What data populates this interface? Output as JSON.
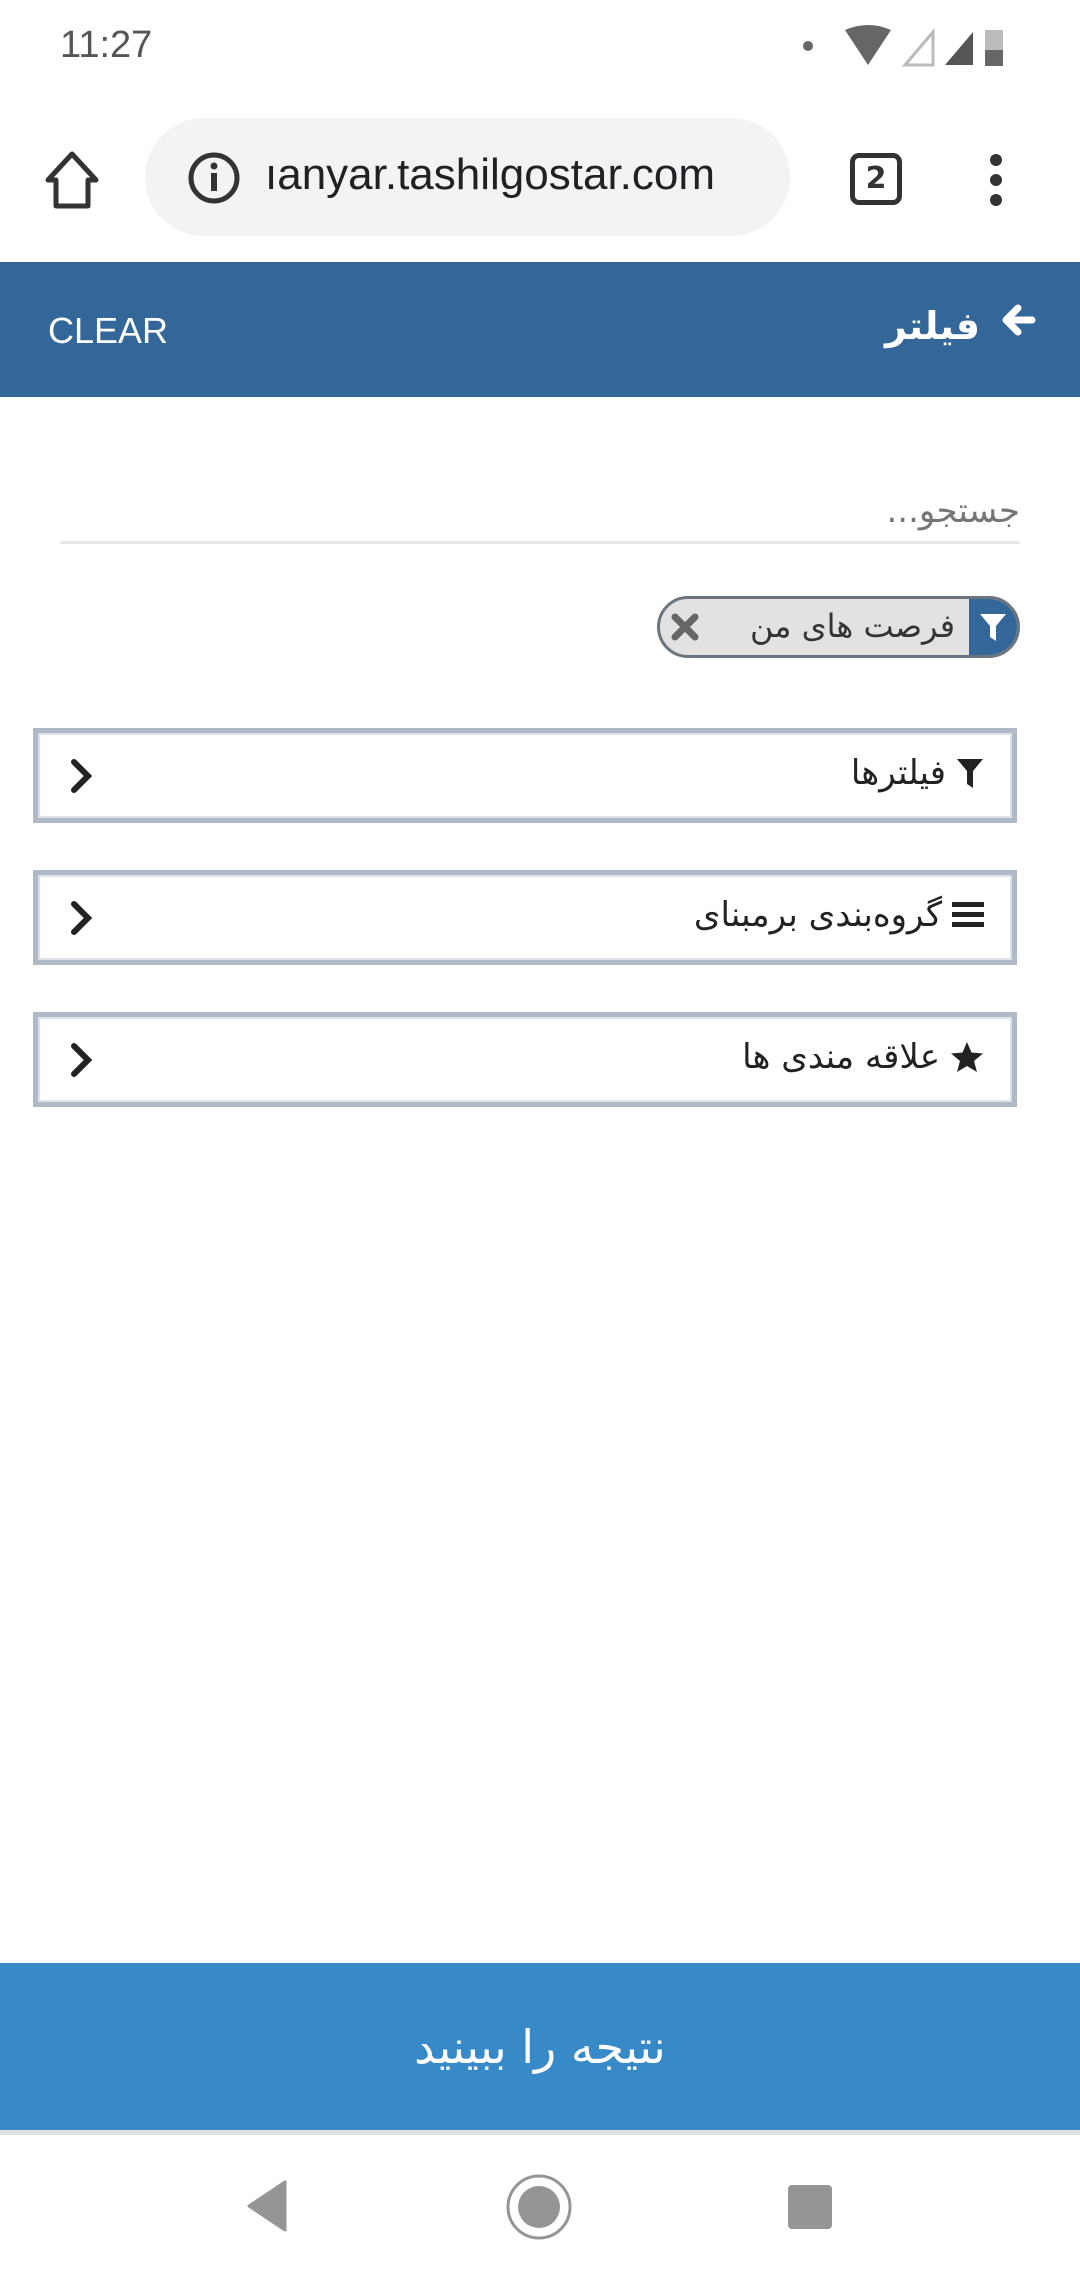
{
  "status_bar": {
    "time": "11:27"
  },
  "browser": {
    "url": "ıanyar.tashilgostar.com",
    "tab_count": "2"
  },
  "header": {
    "clear_label": "CLEAR",
    "title": "فیلتر"
  },
  "search": {
    "placeholder": "جستجو..."
  },
  "active_filter_chip": {
    "label": "فرصت های من"
  },
  "accordions": [
    {
      "label": "فیلترها",
      "icon": "filter-icon"
    },
    {
      "label": "گروه‌بندی برمبنای",
      "icon": "list-icon"
    },
    {
      "label": "علاقه مندی ها",
      "icon": "star-icon"
    }
  ],
  "result_button": {
    "label": "نتیجه را ببینید"
  },
  "colors": {
    "header": "#336699",
    "result_button": "#3889c8"
  }
}
